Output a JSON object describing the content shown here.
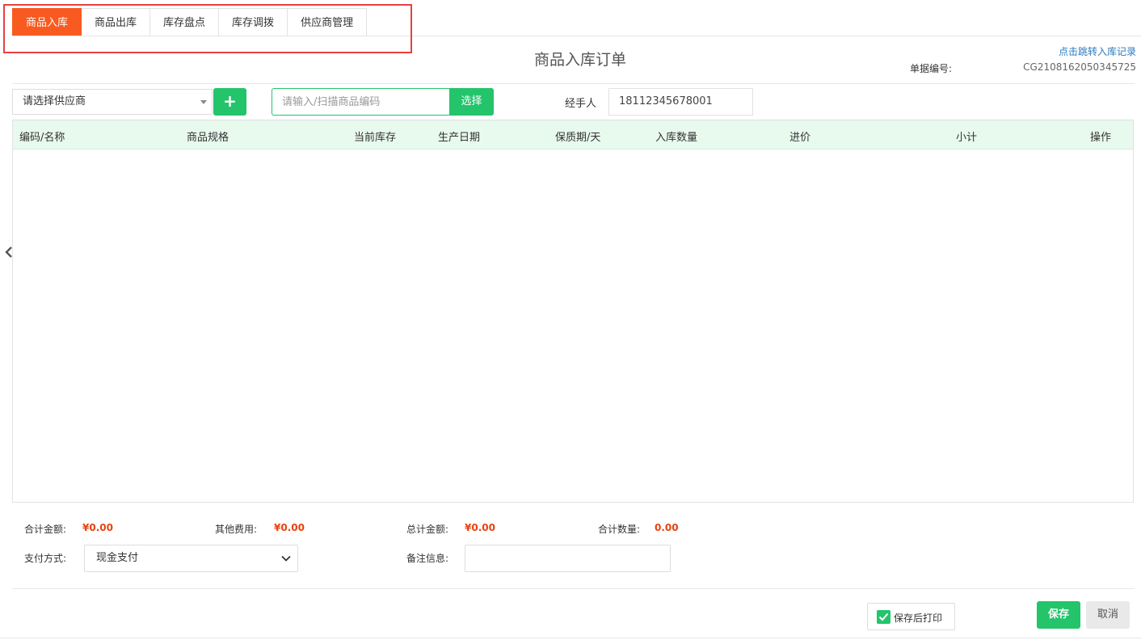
{
  "tabs": [
    {
      "label": "商品入库",
      "active": true
    },
    {
      "label": "商品出库",
      "active": false
    },
    {
      "label": "库存盘点",
      "active": false
    },
    {
      "label": "库存调拨",
      "active": false
    },
    {
      "label": "供应商管理",
      "active": false
    }
  ],
  "order": {
    "title": "商品入库订单",
    "record_link": "点击跳转入库记录",
    "doc_no_label": "单据编号:",
    "doc_no_value": "CG2108162050345725"
  },
  "toolbar": {
    "supplier_placeholder": "请选择供应商",
    "add_label": "+",
    "code_placeholder": "请输入/扫描商品编码",
    "select_label": "选择",
    "handler_label": "经手人",
    "handler_value": "18112345678001"
  },
  "table": {
    "columns": [
      "编码/名称",
      "商品规格",
      "当前库存",
      "生产日期",
      "保质期/天",
      "入库数量",
      "进价",
      "小计",
      "操作"
    ],
    "rows": []
  },
  "summary": {
    "total_amount_label": "合计金额:",
    "total_amount_value": "¥0.00",
    "other_fee_label": "其他费用:",
    "other_fee_value": "¥0.00",
    "grand_total_label": "总计金额:",
    "grand_total_value": "¥0.00",
    "total_qty_label": "合计数量:",
    "total_qty_value": "0.00"
  },
  "payment": {
    "label": "支付方式:",
    "selected": "现金支付",
    "remark_label": "备注信息:",
    "remark_value": ""
  },
  "footer": {
    "print_after_save_label": "保存后打印",
    "print_after_save_checked": true,
    "save_label": "保存",
    "cancel_label": "取消"
  },
  "colors": {
    "accent_orange": "#f85a1f",
    "accent_green": "#24c46b",
    "amount_red": "#e8420f",
    "link_blue": "#2a7ac0"
  }
}
